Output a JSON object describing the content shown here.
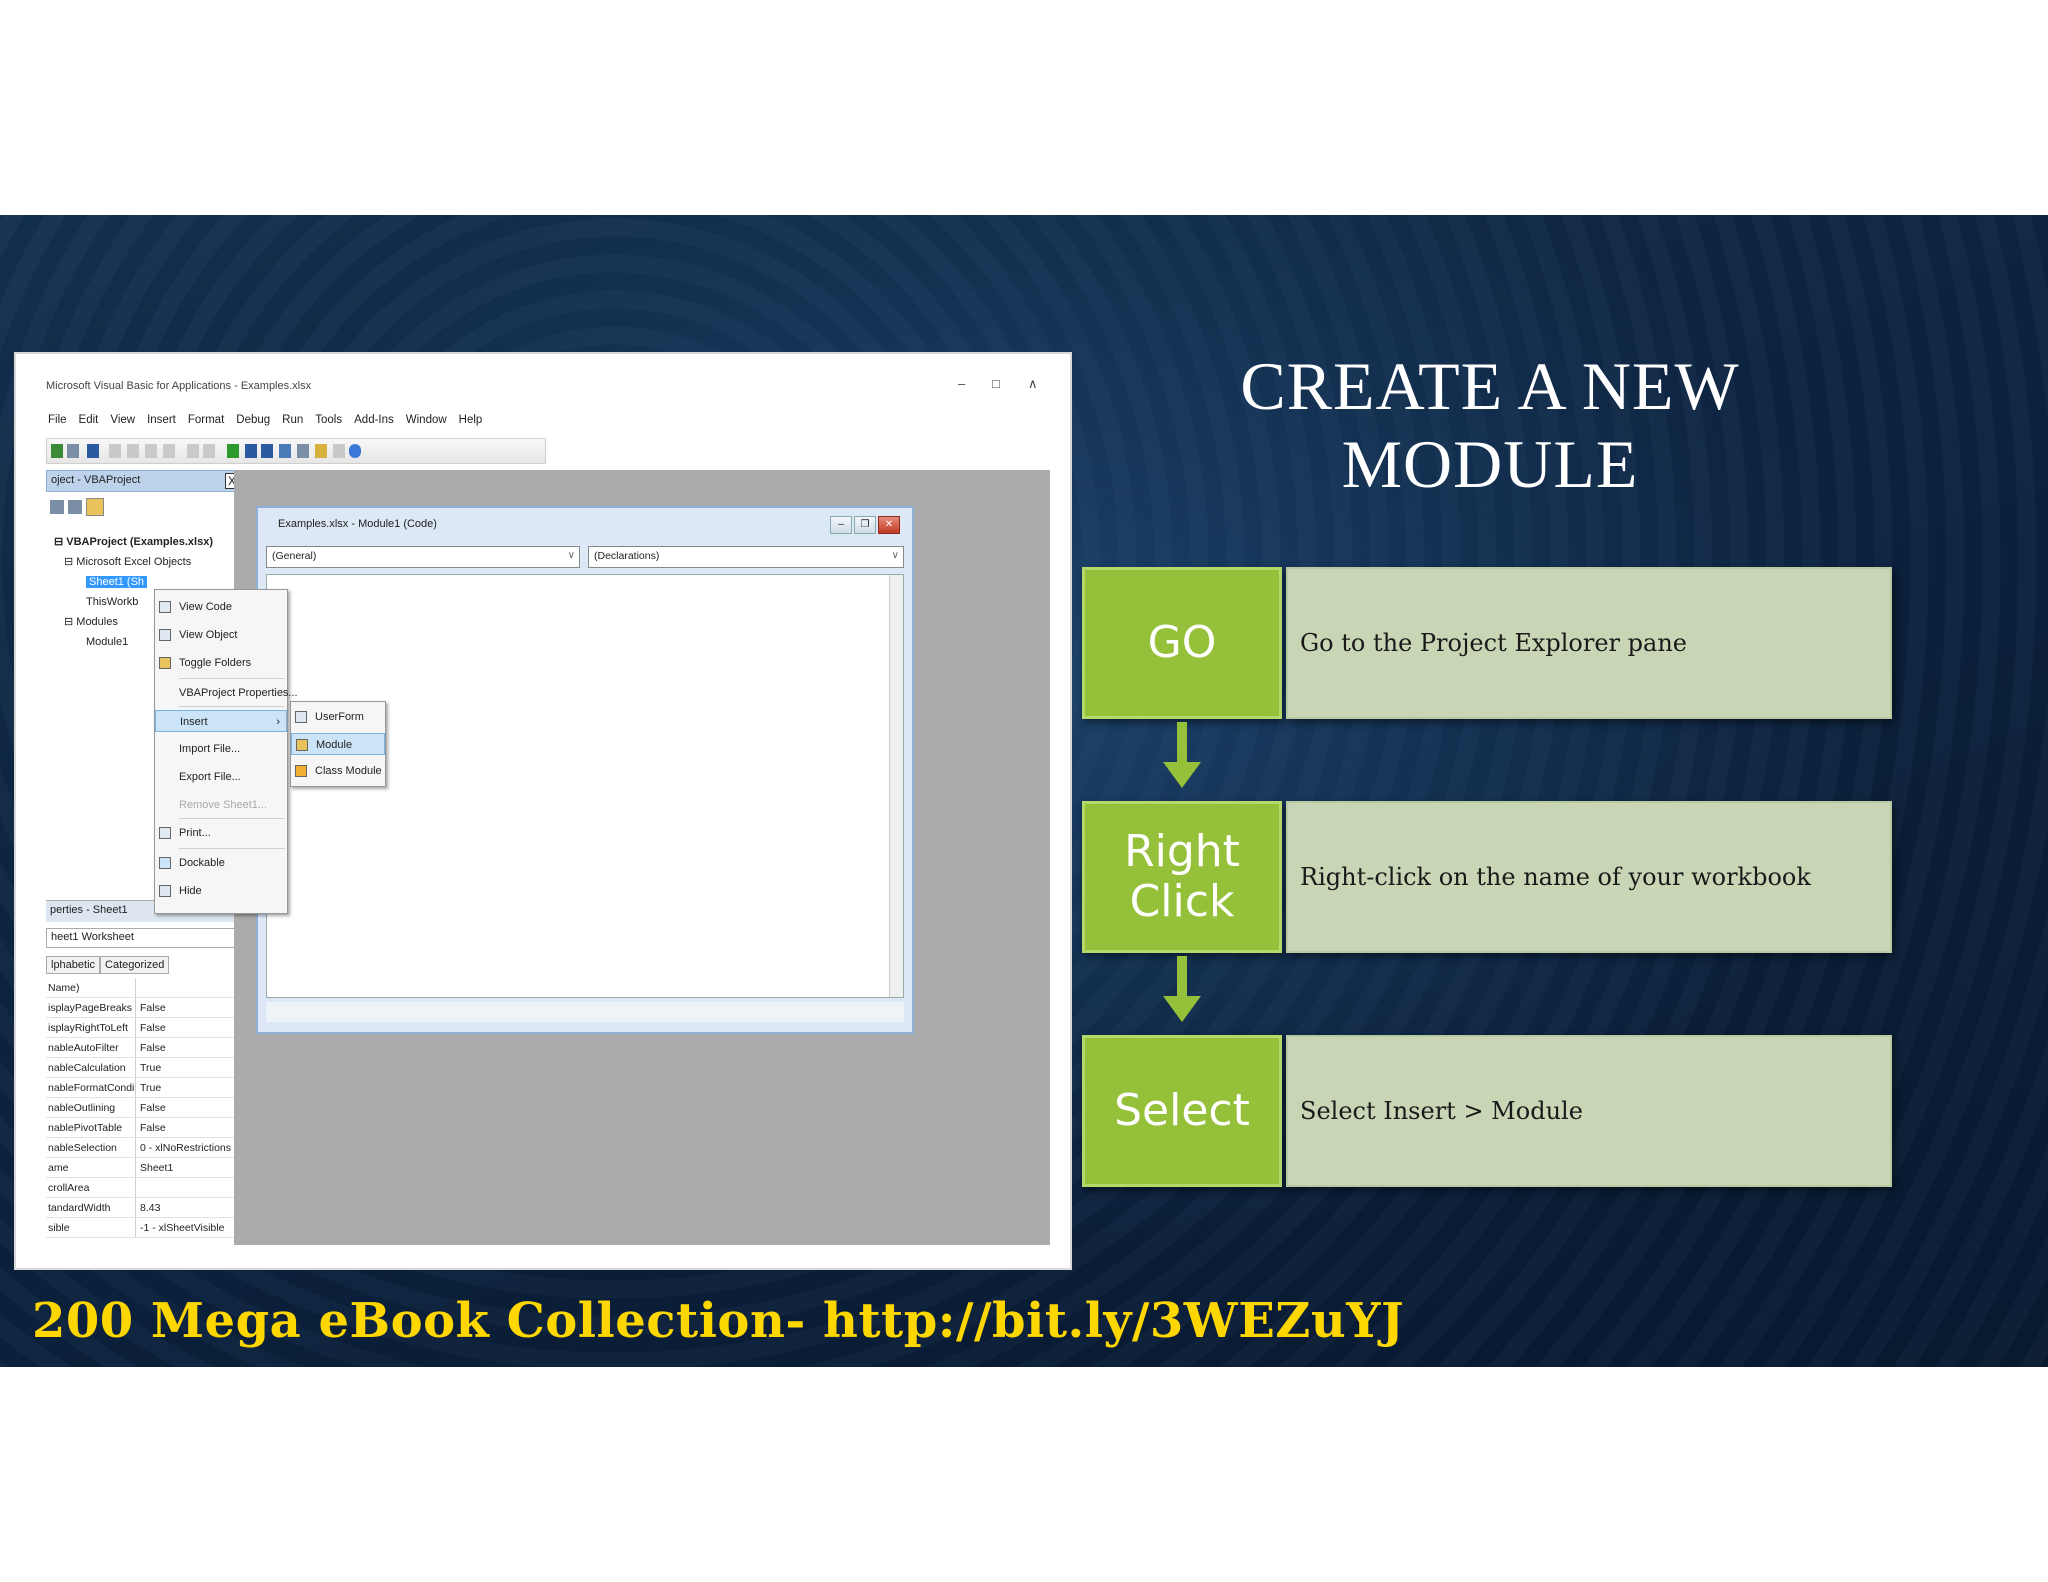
{
  "slide": {
    "title_lines": [
      "CREATE A NEW",
      "MODULE"
    ],
    "footer": "200 Mega eBook Collection- http://bit.ly/3WEZuYJ"
  },
  "steps": [
    {
      "tag": "GO",
      "text": "Go to the Project Explorer pane"
    },
    {
      "tag_lines": [
        "Right",
        "Click"
      ],
      "text": "Right-click on the name of your workbook"
    },
    {
      "tag": "Select",
      "text": "Select Insert > Module"
    }
  ],
  "colors": {
    "accent_green": "#95c13a",
    "step_body": "#c8d6b5",
    "footer_gold": "#ffd700",
    "background": "#0c2340"
  },
  "vba": {
    "window_title": "Microsoft Visual Basic for Applications - Examples.xlsx",
    "window_controls": [
      "–",
      "□",
      "∧"
    ],
    "menu": [
      "File",
      "Edit",
      "View",
      "Insert",
      "Format",
      "Debug",
      "Run",
      "Tools",
      "Add-Ins",
      "Window",
      "Help"
    ],
    "project_pane_title": "oject - VBAProject",
    "project_close": "X",
    "tree": {
      "root": "VBAProject (Examples.xlsx)",
      "excel_objects": "Microsoft Excel Objects",
      "sheet1": "Sheet1 (Sh",
      "thisworkbook": "ThisWorkb",
      "modules": "Modules",
      "module1": "Module1"
    },
    "properties_title": "perties - Sheet1",
    "properties_object": "heet1 Worksheet",
    "properties_tabs": [
      "lphabetic",
      "Categorized"
    ],
    "properties": [
      {
        "k": "Name)",
        "v": ""
      },
      {
        "k": "isplayPageBreaks",
        "v": "False"
      },
      {
        "k": "isplayRightToLeft",
        "v": "False"
      },
      {
        "k": "nableAutoFilter",
        "v": "False"
      },
      {
        "k": "nableCalculation",
        "v": "True"
      },
      {
        "k": "nableFormatConditionsC",
        "v": "True"
      },
      {
        "k": "nableOutlining",
        "v": "False"
      },
      {
        "k": "nablePivotTable",
        "v": "False"
      },
      {
        "k": "nableSelection",
        "v": "0 - xlNoRestrictions"
      },
      {
        "k": "ame",
        "v": "Sheet1"
      },
      {
        "k": "crollArea",
        "v": ""
      },
      {
        "k": "tandardWidth",
        "v": "8.43"
      },
      {
        "k": "sible",
        "v": "-1 - xlSheetVisible"
      }
    ],
    "code_window_title": "Examples.xlsx - Module1 (Code)",
    "combo_left": "(General)",
    "combo_right": "(Declarations)",
    "context_menu": {
      "view_code": "View Code",
      "view_object": "View Object",
      "toggle_folders": "Toggle Folders",
      "properties": "VBAProject Properties...",
      "insert": "Insert",
      "import": "Import File...",
      "export": "Export File...",
      "remove": "Remove Sheet1...",
      "print": "Print...",
      "dockable": "Dockable",
      "hide": "Hide"
    },
    "submenu": {
      "userform": "UserForm",
      "module": "Module",
      "class_module": "Class Module"
    }
  }
}
